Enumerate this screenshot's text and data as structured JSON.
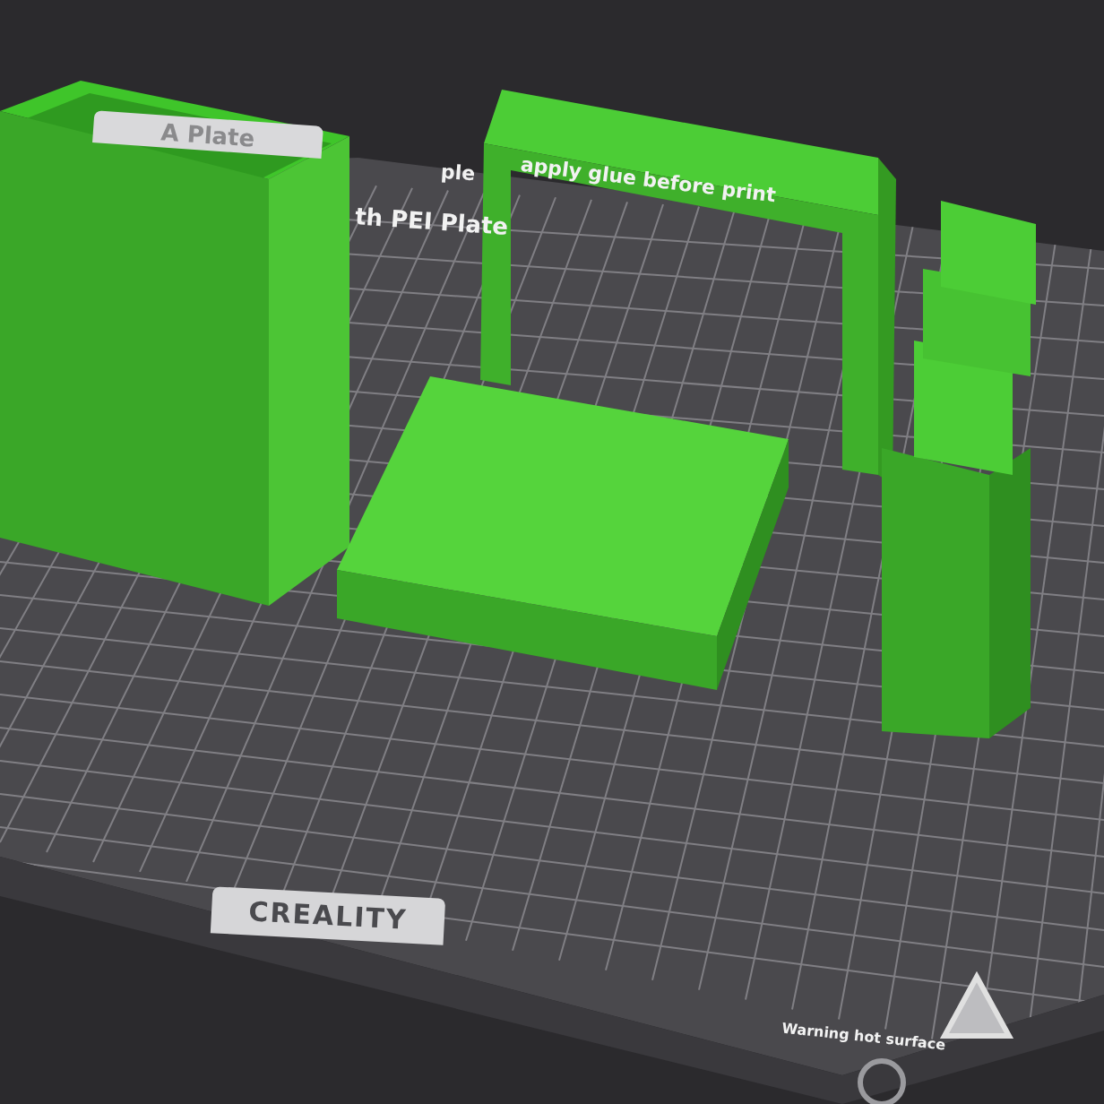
{
  "plate_tab": {
    "label": "A Plate"
  },
  "bed_notes": [
    {
      "text": "ple"
    },
    {
      "text": "apply glue before print"
    }
  ],
  "plate_type": "th PEI Plate",
  "brand": "CREALITY",
  "warning": "Warning hot surface"
}
